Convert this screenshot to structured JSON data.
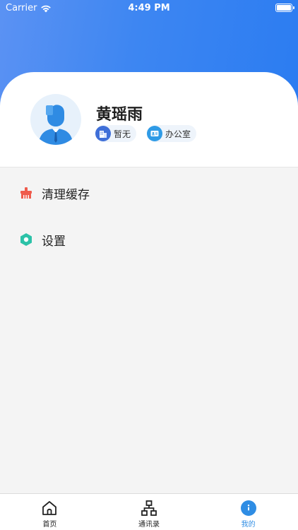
{
  "status_bar": {
    "carrier": "Carrier",
    "time": "4:49 PM"
  },
  "profile": {
    "name": "黄瑶雨",
    "organization": "暂无",
    "department": "办公室"
  },
  "menu": {
    "items": [
      {
        "label": "清理缓存",
        "icon": "broom-icon",
        "color": "#ef5b4c"
      },
      {
        "label": "设置",
        "icon": "settings-icon",
        "color": "#2cc2a8"
      }
    ]
  },
  "tabbar": {
    "tabs": [
      {
        "label": "首页",
        "icon": "home-icon",
        "active": false
      },
      {
        "label": "通讯录",
        "icon": "org-chart-icon",
        "active": false
      },
      {
        "label": "我的",
        "icon": "profile-icon",
        "active": true
      }
    ]
  },
  "colors": {
    "header_gradient_start": "#5b92f3",
    "header_gradient_end": "#2b7cf1",
    "active_tab": "#2f8de4"
  }
}
